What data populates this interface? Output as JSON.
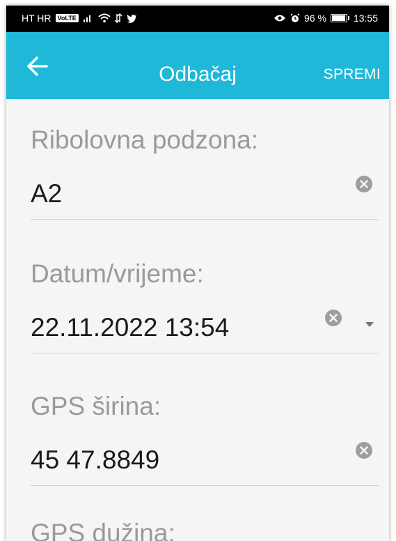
{
  "status_bar": {
    "carrier": "HT HR",
    "volte": "VoLTE",
    "battery": "96 %",
    "time": "13:55"
  },
  "app_bar": {
    "title": "Odbačaj",
    "save_label": "SPREMI"
  },
  "fields": [
    {
      "label": "Ribolovna podzona:",
      "value": "A2"
    },
    {
      "label": "Datum/vrijeme:",
      "value": "22.11.2022 13:54"
    },
    {
      "label": "GPS širina:",
      "value": "45 47.8849"
    },
    {
      "label": "GPS dužina:"
    }
  ],
  "colors": {
    "app_bar": "#1fb8d8",
    "background": "#f5f5f5",
    "label": "#9a9a9a",
    "value": "#1a1a1a",
    "icon": "#9e9e9e"
  }
}
